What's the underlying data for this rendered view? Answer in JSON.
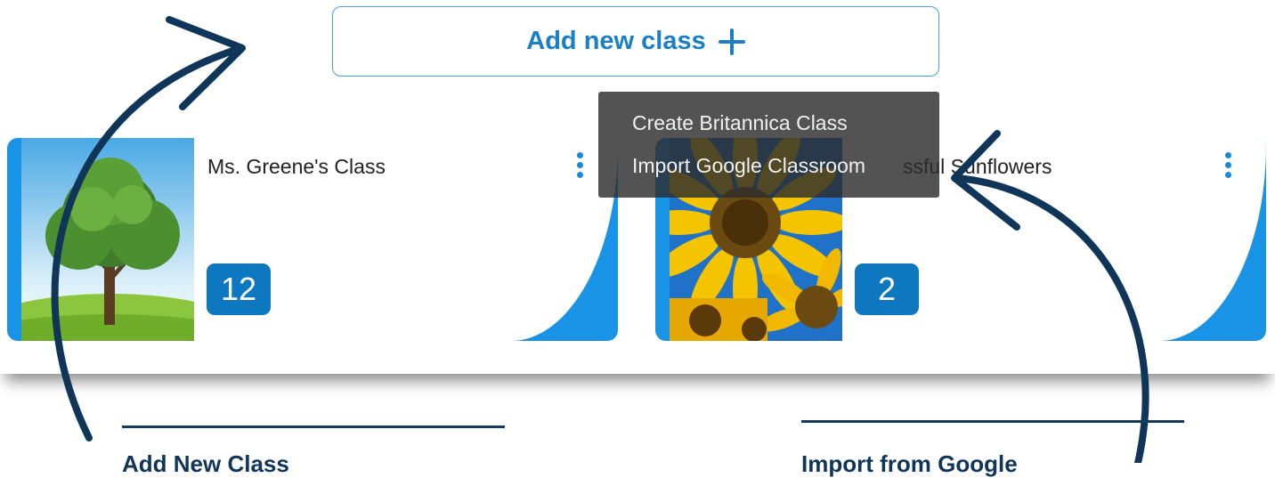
{
  "add_button": {
    "label": "Add new class"
  },
  "dropdown": {
    "items": [
      "Create Britannica Class",
      "Import Google Classroom"
    ]
  },
  "classes": [
    {
      "title": "Ms. Greene's Class",
      "count": "12",
      "image": "tree-thumbnail"
    },
    {
      "title": "Mr. Successful Sunflowers",
      "title_visible_tail": "ssful Sunflowers",
      "count": "2",
      "image": "sunflower-thumbnail"
    }
  ],
  "annotations": {
    "left_label": "Add New Class",
    "right_label": "Import from Google"
  },
  "colors": {
    "accent": "#1a7fc4",
    "card_border": "#1993e5",
    "badge": "#0d78c0",
    "annotation": "#0f3558"
  }
}
